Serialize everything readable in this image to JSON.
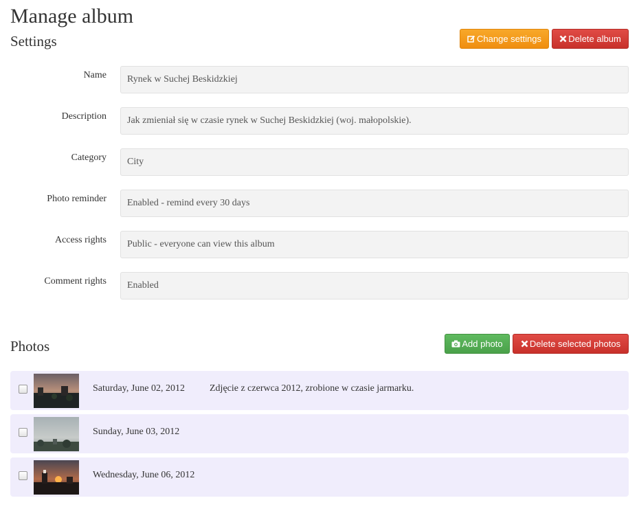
{
  "page": {
    "title": "Manage album"
  },
  "settings": {
    "title": "Settings",
    "change_button": "Change settings",
    "delete_button": "Delete album",
    "fields": [
      {
        "label": "Name",
        "value": "Rynek w Suchej Beskidzkiej"
      },
      {
        "label": "Description",
        "value": "Jak zmieniał się w czasie rynek w Suchej Beskidzkiej (woj. małopolskie)."
      },
      {
        "label": "Category",
        "value": "City"
      },
      {
        "label": "Photo reminder",
        "value": "Enabled - remind every 30 days"
      },
      {
        "label": "Access rights",
        "value": "Public - everyone can view this album"
      },
      {
        "label": "Comment rights",
        "value": "Enabled"
      }
    ]
  },
  "photos": {
    "title": "Photos",
    "add_button": "Add photo",
    "delete_button": "Delete selected photos",
    "items": [
      {
        "date": "Saturday, June 02, 2012",
        "description": "Zdjęcie z czerwca 2012, zrobione w czasie jarmarku."
      },
      {
        "date": "Sunday, June 03, 2012",
        "description": ""
      },
      {
        "date": "Wednesday, June 06, 2012",
        "description": ""
      }
    ]
  },
  "icons": {
    "change_settings": "edit-icon",
    "delete_album": "close-icon",
    "add_photo": "camera-icon",
    "delete_photos": "close-icon"
  },
  "colors": {
    "warning": "#f0901a",
    "danger": "#d9403a",
    "success": "#54aa54",
    "field_bg": "#f3f3f3",
    "row_bg": "#f0edfc"
  }
}
